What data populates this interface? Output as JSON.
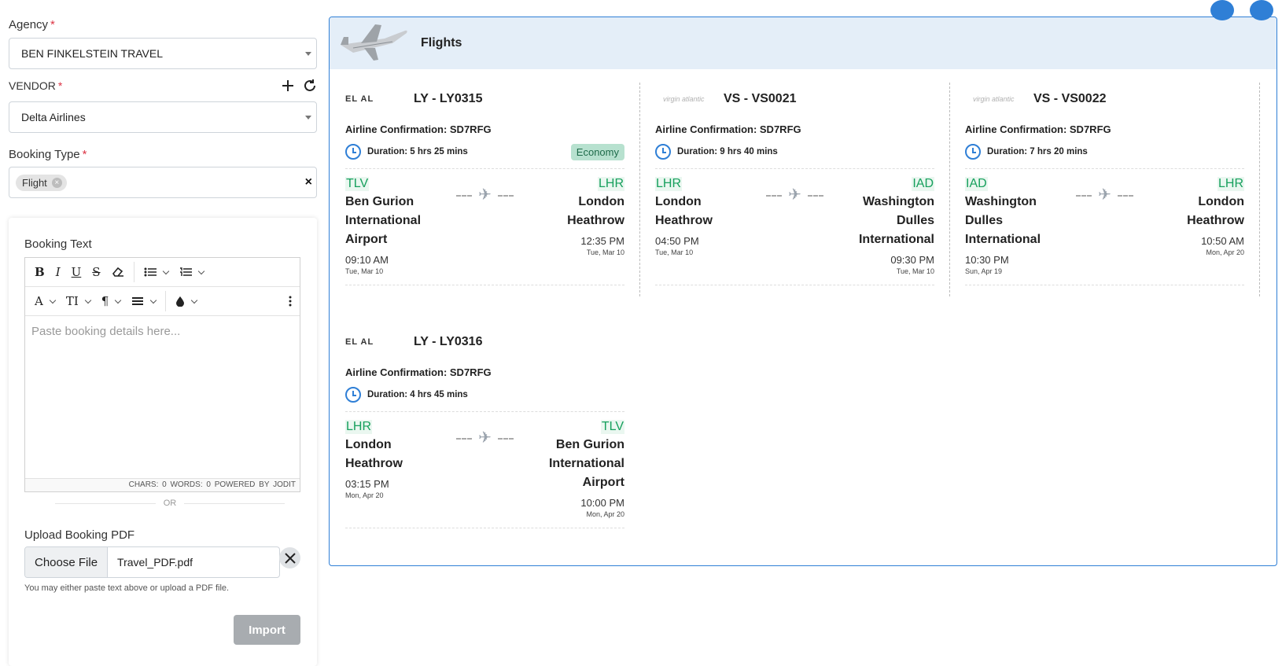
{
  "form": {
    "agency_label": "Agency",
    "agency_value": "BEN FINKELSTEIN TRAVEL",
    "vendor_label": "VENDOR",
    "vendor_value": "Delta Airlines",
    "booking_type_label": "Booking Type",
    "booking_type_chip": "Flight"
  },
  "import_card": {
    "booking_text_label": "Booking Text",
    "editor_placeholder": "Paste booking details here...",
    "status_bar": "CHARS: 0  WORDS: 0  POWERED BY JODIT",
    "or_text": "OR",
    "upload_label": "Upload Booking PDF",
    "choose_file": "Choose File",
    "file_name": "Travel_PDF.pdf",
    "hint": "You may either paste text above or upload a PDF file.",
    "import_button": "Import"
  },
  "flights_panel": {
    "title": "Flights",
    "segments": [
      {
        "logo": "EL AL",
        "flight_no": "LY - LY0315",
        "confirmation": "Airline Confirmation: SD7RFG",
        "duration": "Duration: 5 hrs 25 mins",
        "cabin": "Economy",
        "from_code": "TLV",
        "from_city": "Ben Gurion International Airport",
        "from_time": "09:10 AM",
        "from_date": "Tue, Mar 10",
        "to_code": "LHR",
        "to_city": "London Heathrow",
        "to_time": "12:35 PM",
        "to_date": "Tue, Mar 10"
      },
      {
        "logo": "virgin atlantic",
        "flight_no": "VS - VS0021",
        "confirmation": "Airline Confirmation: SD7RFG",
        "duration": "Duration: 9 hrs 40 mins",
        "cabin": "",
        "from_code": "LHR",
        "from_city": "London Heathrow",
        "from_time": "04:50 PM",
        "from_date": "Tue, Mar 10",
        "to_code": "IAD",
        "to_city": "Washington Dulles International",
        "to_time": "09:30 PM",
        "to_date": "Tue, Mar 10"
      },
      {
        "logo": "virgin atlantic",
        "flight_no": "VS - VS0022",
        "confirmation": "Airline Confirmation: SD7RFG",
        "duration": "Duration: 7 hrs 20 mins",
        "cabin": "",
        "from_code": "IAD",
        "from_city": "Washington Dulles International",
        "from_time": "10:30 PM",
        "from_date": "Sun, Apr 19",
        "to_code": "LHR",
        "to_city": "London Heathrow",
        "to_time": "10:50 AM",
        "to_date": "Mon, Apr 20"
      },
      {
        "logo": "EL AL",
        "flight_no": "LY - LY0316",
        "confirmation": "Airline Confirmation: SD7RFG",
        "duration": "Duration: 4 hrs 45 mins",
        "cabin": "",
        "from_code": "LHR",
        "from_city": "London Heathrow",
        "from_time": "03:15 PM",
        "from_date": "Mon, Apr 20",
        "to_code": "TLV",
        "to_city": "Ben Gurion International Airport",
        "to_time": "10:00 PM",
        "to_date": "Mon, Apr 20"
      }
    ]
  },
  "colors": {
    "accent": "#2f7fd6",
    "airport_code": "#17a05d",
    "required": "#dc3545"
  }
}
